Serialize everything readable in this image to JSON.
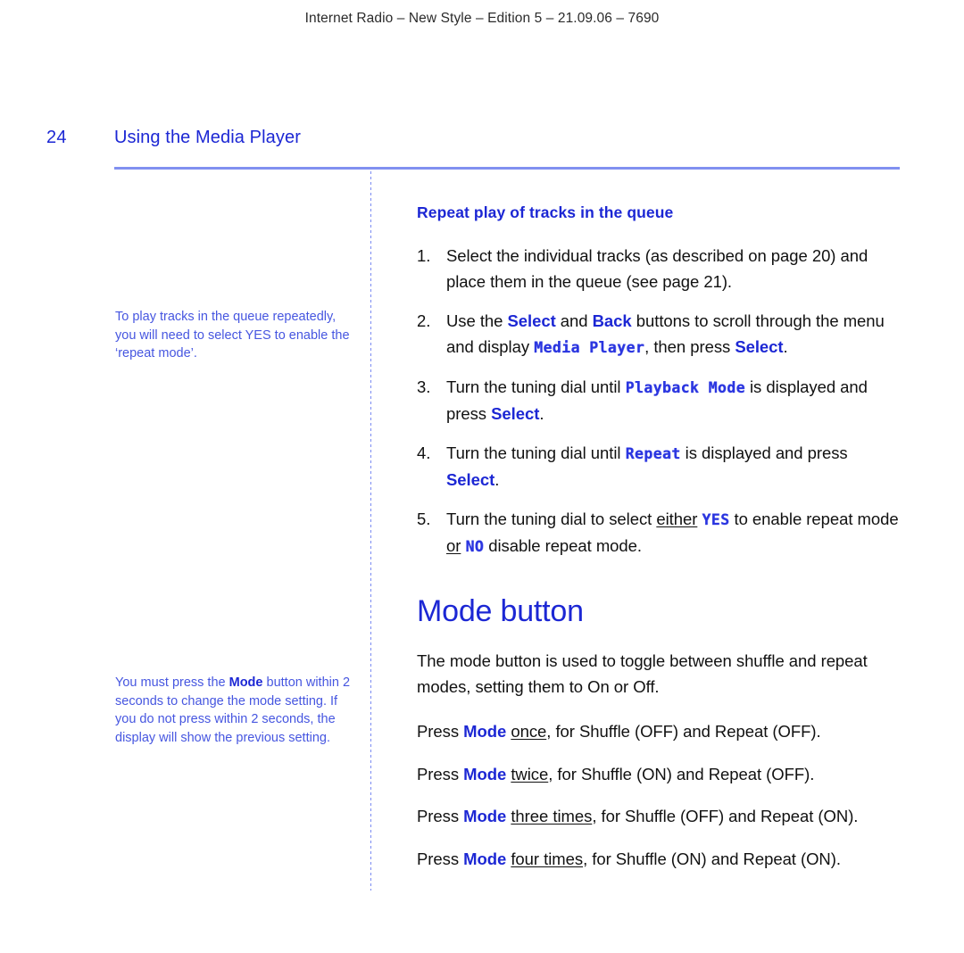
{
  "running_header": "Internet Radio – New Style – Edition 5 – 21.09.06 – 7690",
  "page": {
    "number": "24",
    "title": "Using the Media Player"
  },
  "colors": {
    "brand_blue": "#1c27d4",
    "note_blue": "#4656e0",
    "rule_blue": "#8190f0",
    "lcd_blue": "#2a35e0",
    "body_black": "#111111"
  },
  "margin_notes": [
    {
      "id": "repeat-mode-note",
      "parts": [
        {
          "type": "text",
          "text": "To play tracks in the queue repeatedly, you will need to select YES to enable the ‘repeat mode’."
        }
      ]
    },
    {
      "id": "mode-timing-note",
      "parts": [
        {
          "type": "text",
          "text": "You must press the "
        },
        {
          "type": "bold",
          "text": "Mode"
        },
        {
          "type": "text",
          "text": " button within 2 seconds to change the mode setting. If you do not press within 2 seconds, the display will show the previous setting."
        }
      ]
    }
  ],
  "sections": [
    {
      "id": "repeat-play",
      "heading": "Repeat play of tracks in the queue",
      "steps": [
        {
          "number": "1.",
          "parts": [
            {
              "type": "text",
              "text": "Select the individual tracks (as described on page 20) and place them in the queue (see page 21)."
            }
          ]
        },
        {
          "number": "2.",
          "parts": [
            {
              "type": "text",
              "text": "Use the "
            },
            {
              "type": "key",
              "text": "Select"
            },
            {
              "type": "text",
              "text": " and "
            },
            {
              "type": "key",
              "text": "Back"
            },
            {
              "type": "text",
              "text": " buttons to scroll through the menu and display "
            },
            {
              "type": "lcd",
              "text": "Media Player"
            },
            {
              "type": "text",
              "text": ", then press "
            },
            {
              "type": "key",
              "text": "Select"
            },
            {
              "type": "text",
              "text": "."
            }
          ]
        },
        {
          "number": "3.",
          "parts": [
            {
              "type": "text",
              "text": "Turn the tuning dial until "
            },
            {
              "type": "lcd",
              "text": "Playback Mode"
            },
            {
              "type": "text",
              "text": " is displayed and press "
            },
            {
              "type": "key",
              "text": "Select"
            },
            {
              "type": "text",
              "text": "."
            }
          ]
        },
        {
          "number": "4.",
          "parts": [
            {
              "type": "text",
              "text": "Turn the tuning dial until "
            },
            {
              "type": "lcd",
              "text": "Repeat"
            },
            {
              "type": "text",
              "text": " is displayed and press "
            },
            {
              "type": "key",
              "text": "Select"
            },
            {
              "type": "text",
              "text": "."
            }
          ]
        },
        {
          "number": "5.",
          "parts": [
            {
              "type": "text",
              "text": "Turn the tuning dial to select "
            },
            {
              "type": "underline",
              "text": "either"
            },
            {
              "type": "text",
              "text": " "
            },
            {
              "type": "lcd",
              "text": "YES"
            },
            {
              "type": "text",
              "text": " to enable repeat mode "
            },
            {
              "type": "underline",
              "text": "or"
            },
            {
              "type": "text",
              "text": " "
            },
            {
              "type": "lcd",
              "text": "NO"
            },
            {
              "type": "text",
              "text": " disable repeat mode."
            }
          ]
        }
      ]
    },
    {
      "id": "mode-button",
      "heading": "Mode button",
      "paragraph": {
        "parts": [
          {
            "type": "text",
            "text": "The mode button is used to toggle between shuffle and repeat modes, setting them to On or Off."
          }
        ]
      },
      "press_lines": [
        {
          "parts": [
            {
              "type": "text",
              "text": "Press "
            },
            {
              "type": "key",
              "text": "Mode"
            },
            {
              "type": "text",
              "text": " "
            },
            {
              "type": "underline",
              "text": "once"
            },
            {
              "type": "text",
              "text": ", for Shuffle (OFF) and Repeat (OFF)."
            }
          ]
        },
        {
          "parts": [
            {
              "type": "text",
              "text": "Press "
            },
            {
              "type": "key",
              "text": "Mode"
            },
            {
              "type": "text",
              "text": " "
            },
            {
              "type": "underline",
              "text": "twice"
            },
            {
              "type": "text",
              "text": ", for Shuffle (ON) and Repeat (OFF)."
            }
          ]
        },
        {
          "parts": [
            {
              "type": "text",
              "text": "Press "
            },
            {
              "type": "key",
              "text": "Mode"
            },
            {
              "type": "text",
              "text": " "
            },
            {
              "type": "underline",
              "text": "three times"
            },
            {
              "type": "text",
              "text": ", for Shuffle (OFF) and Repeat (ON)."
            }
          ]
        },
        {
          "parts": [
            {
              "type": "text",
              "text": "Press "
            },
            {
              "type": "key",
              "text": "Mode"
            },
            {
              "type": "text",
              "text": " "
            },
            {
              "type": "underline",
              "text": "four times"
            },
            {
              "type": "text",
              "text": ", for Shuffle (ON) and Repeat (ON)."
            }
          ]
        }
      ]
    }
  ]
}
